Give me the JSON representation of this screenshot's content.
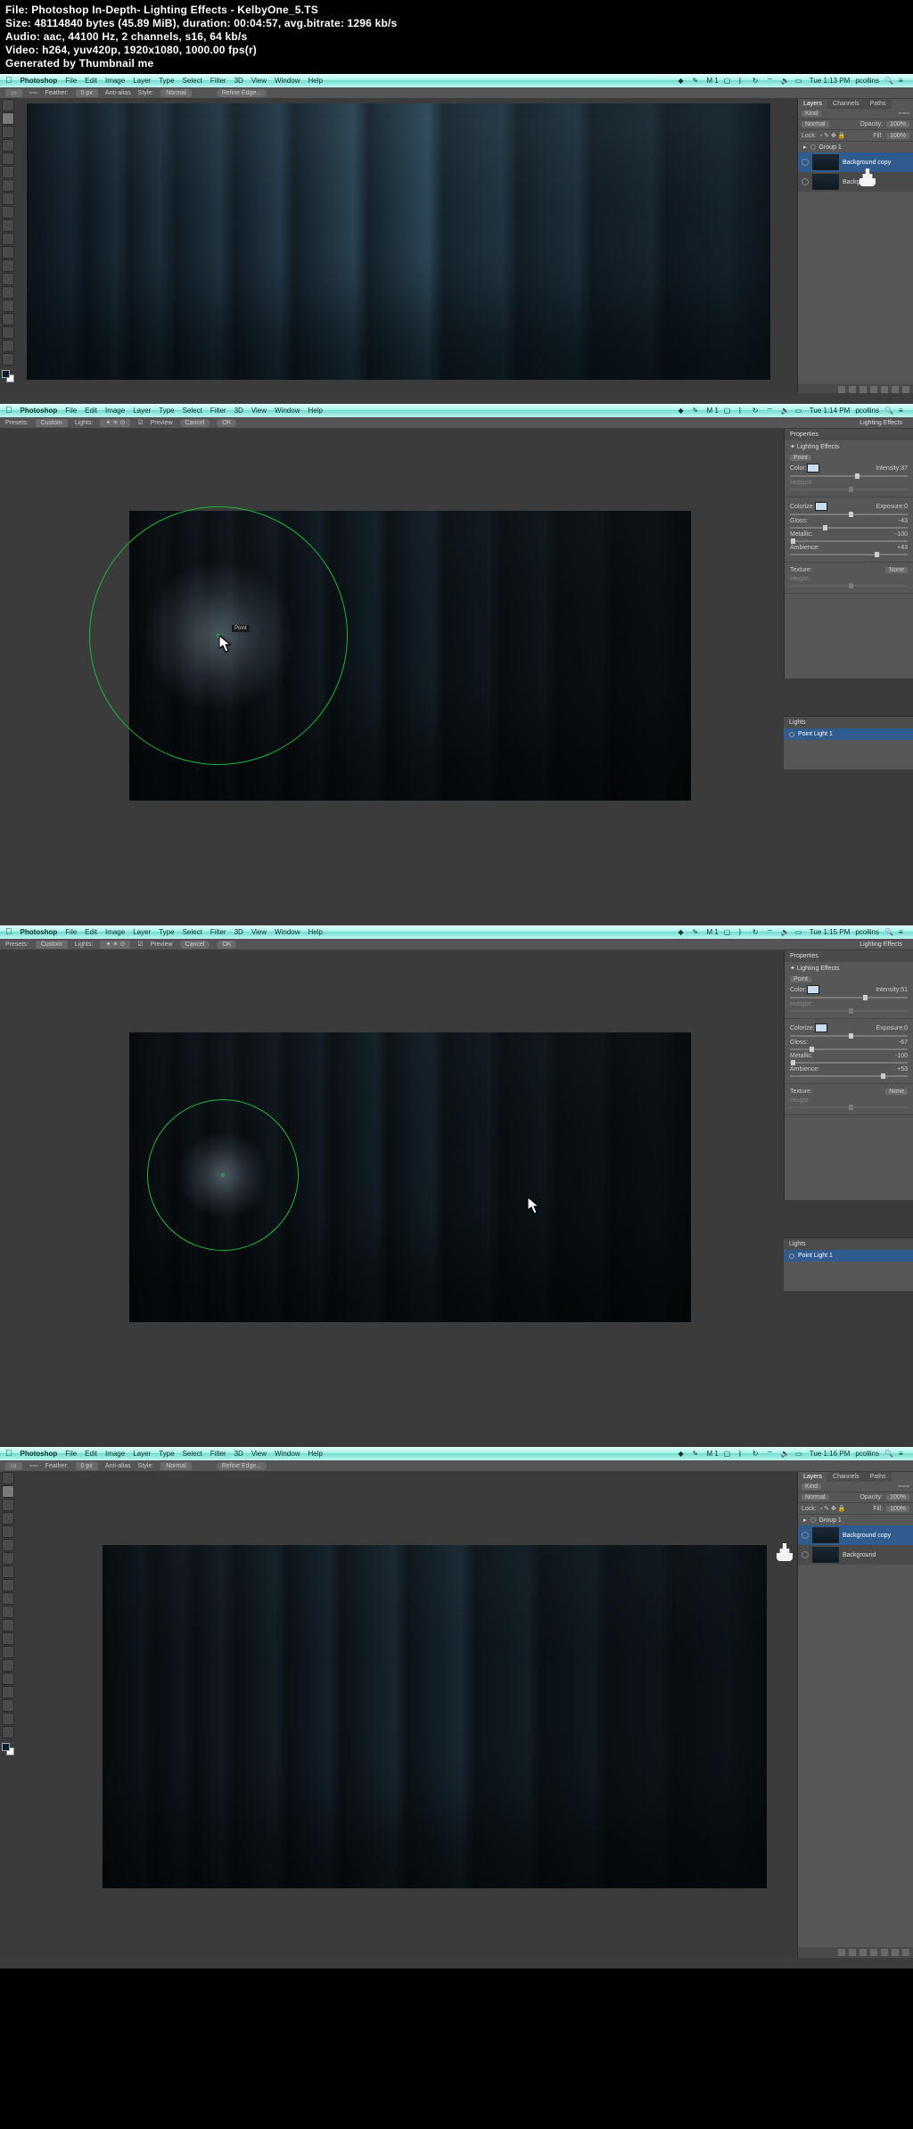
{
  "info": {
    "file": "File: Photoshop In-Depth- Lighting Effects - KelbyOne_5.TS",
    "size": "Size: 48114840 bytes (45.89 MiB), duration: 00:04:57, avg.bitrate: 1296 kb/s",
    "audio": "Audio: aac, 44100 Hz, 2 channels, s16, 64 kb/s",
    "video": "Video: h264, yuv420p, 1920x1080, 1000.00 fps(r)",
    "gen": "Generated by Thumbnail me"
  },
  "menu": {
    "app": "Photoshop",
    "items": [
      "File",
      "Edit",
      "Image",
      "Layer",
      "Type",
      "Select",
      "Filter",
      "3D",
      "View",
      "Window",
      "Help"
    ]
  },
  "status_right": {
    "times": [
      "Tue 1:13 PM",
      "Tue 1:14 PM",
      "Tue 1:15 PM",
      "Tue 1:16 PM"
    ],
    "user": "pcollins",
    "batt": "M 1"
  },
  "optbar_select": {
    "feather_lbl": "Feather:",
    "feather_val": "0 px",
    "aa": "Anti-alias",
    "style": "Style:",
    "style_val": "Normal",
    "refine": "Refine Edge..."
  },
  "optbar_lighting": {
    "presets": "Presets:",
    "presets_val": "Custom",
    "lights": "Lights:",
    "preview": "Preview",
    "cancel": "Cancel",
    "ok": "OK",
    "title": "Lighting Effects"
  },
  "layers_panel": {
    "tabs": [
      "Layers",
      "Channels",
      "Paths"
    ],
    "kind": "Kind",
    "blend": "Normal",
    "opacity_lbl": "Opacity:",
    "opacity_val": "100%",
    "lock": "Lock:",
    "fill_lbl": "Fill:",
    "fill_val": "100%",
    "group": "Group 1",
    "layer1": "Background copy",
    "layer2": "Background"
  },
  "properties_panel": {
    "title": "Properties",
    "fx": "Lighting Effects",
    "type": "Point",
    "color_lbl": "Color:",
    "intensity_lbl": "Intensity:",
    "hotspot_lbl": "Hotspot:",
    "colorize_lbl": "Colorize:",
    "exposure_lbl": "Exposure:",
    "gloss_lbl": "Gloss:",
    "metallic_lbl": "Metallic:",
    "ambience_lbl": "Ambience:",
    "texture_lbl": "Texture:",
    "texture_val": "None",
    "height_lbl": "Height:"
  },
  "props_shot2": {
    "intensity": "37",
    "exposure": "0",
    "gloss": "-43",
    "metallic": "-100",
    "ambience": "+43"
  },
  "props_shot3": {
    "intensity": "51",
    "exposure": "0",
    "gloss": "-67",
    "metallic": "-100",
    "ambience": "+53"
  },
  "lights_panel": {
    "title": "Lights",
    "light1": "Point Light 1"
  }
}
